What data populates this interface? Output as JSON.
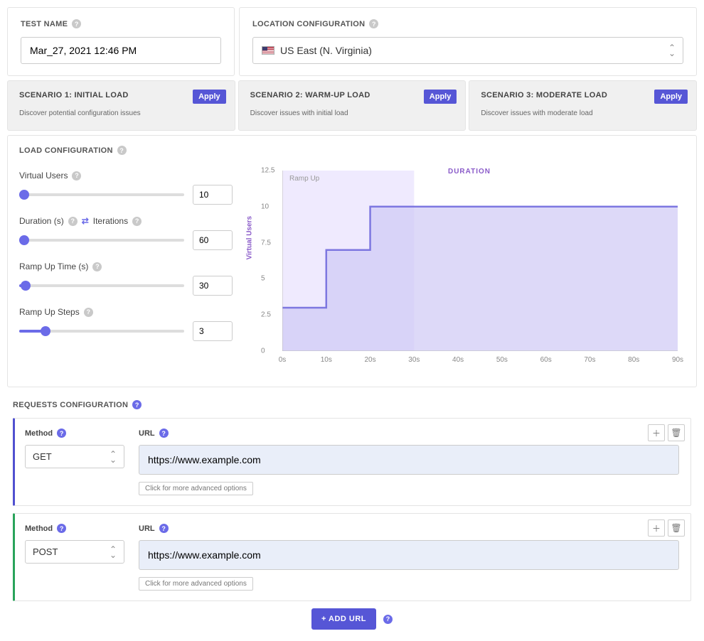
{
  "header": {
    "test_name_label": "TEST NAME",
    "test_name_value": "Mar_27, 2021 12:46 PM",
    "location_label": "LOCATION CONFIGURATION",
    "location_value": "US East (N. Virginia)"
  },
  "scenarios": [
    {
      "title": "SCENARIO 1: INITIAL LOAD",
      "desc": "Discover potential configuration issues",
      "apply": "Apply"
    },
    {
      "title": "SCENARIO 2: WARM-UP LOAD",
      "desc": "Discover issues with initial load",
      "apply": "Apply"
    },
    {
      "title": "SCENARIO 3: MODERATE LOAD",
      "desc": "Discover issues with moderate load",
      "apply": "Apply"
    }
  ],
  "load": {
    "section_label": "LOAD CONFIGURATION",
    "virtual_users_label": "Virtual Users",
    "virtual_users_value": "10",
    "duration_label": "Duration (s)",
    "iterations_label": "Iterations",
    "duration_value": "60",
    "rampup_time_label": "Ramp Up Time (s)",
    "rampup_time_value": "30",
    "rampup_steps_label": "Ramp Up Steps",
    "rampup_steps_value": "3",
    "chart_annotation": "Ramp Up",
    "y_axis_label": "Virtual Users",
    "x_axis_label": "DURATION"
  },
  "chart_data": {
    "type": "area",
    "x": [
      0,
      10,
      10,
      20,
      20,
      30,
      90
    ],
    "y": [
      3,
      3,
      7,
      7,
      10,
      10,
      10
    ],
    "xlabel": "DURATION",
    "ylabel": "Virtual Users",
    "x_ticks": [
      "0s",
      "10s",
      "20s",
      "30s",
      "40s",
      "50s",
      "60s",
      "70s",
      "80s",
      "90s"
    ],
    "y_ticks": [
      "0",
      "2.5",
      "5",
      "7.5",
      "10",
      "12.5"
    ],
    "xlim": [
      0,
      90
    ],
    "ylim": [
      0,
      12.5
    ],
    "ramp_region_end_x": 30,
    "annotation": "Ramp Up"
  },
  "requests": {
    "section_label": "REQUESTS CONFIGURATION",
    "method_label": "Method",
    "url_label": "URL",
    "advanced_label": "Click for more advanced options",
    "add_url_label": "+  ADD URL",
    "items": [
      {
        "method": "GET",
        "url": "https://www.example.com",
        "accent": "blue"
      },
      {
        "method": "POST",
        "url": "https://www.example.com",
        "accent": "green"
      }
    ]
  }
}
